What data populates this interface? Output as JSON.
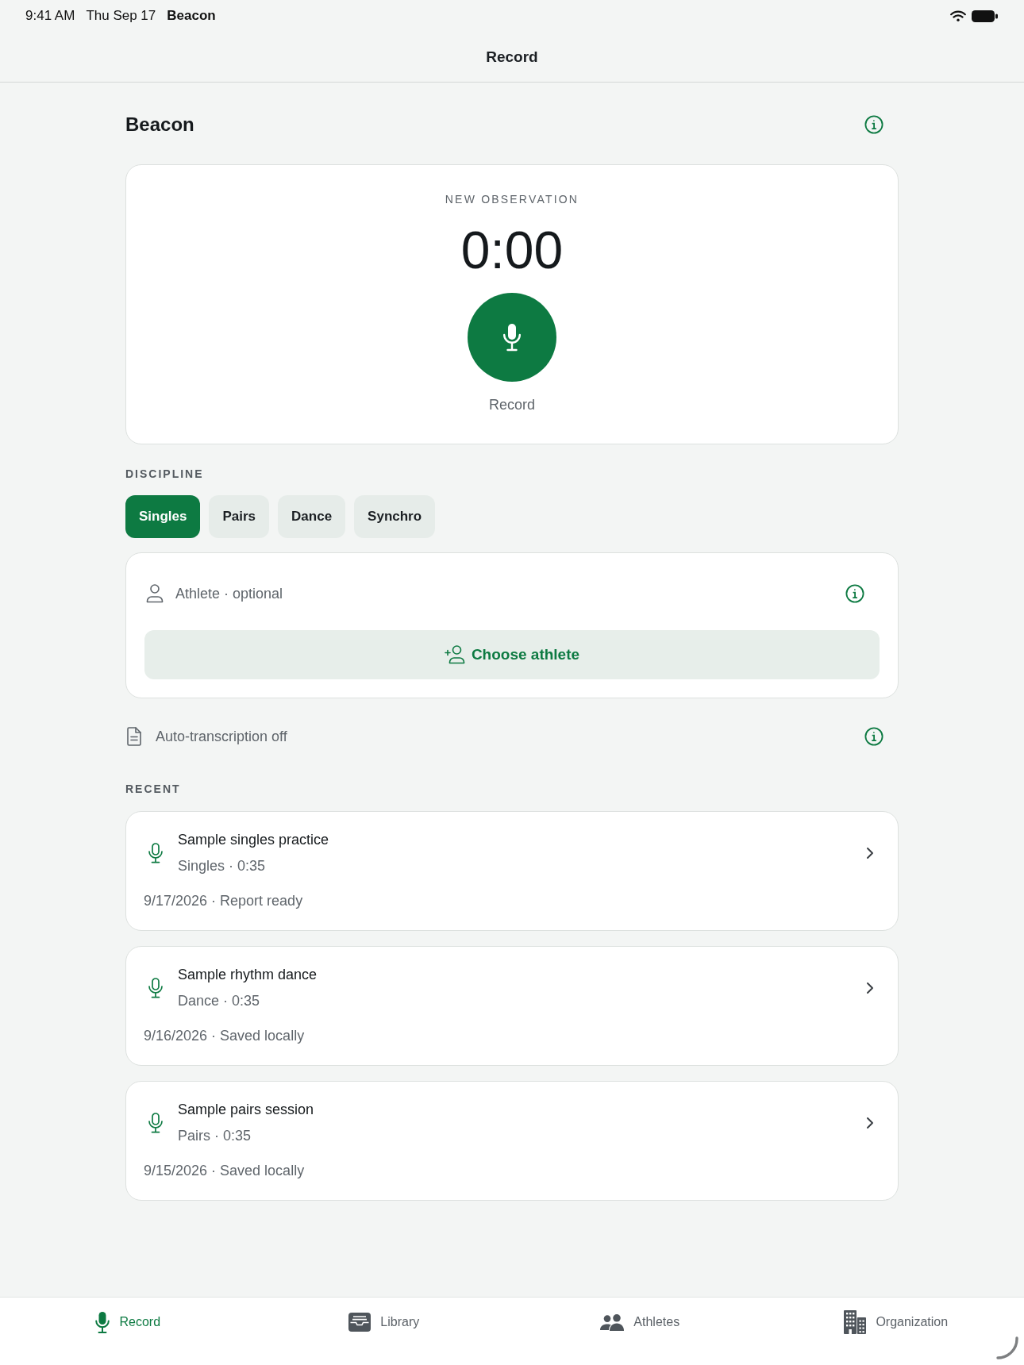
{
  "status_bar": {
    "time": "9:41 AM",
    "date": "Thu Sep 17",
    "app_name": "Beacon"
  },
  "nav_bar": {
    "title": "Record"
  },
  "header": {
    "title": "Beacon"
  },
  "record_card": {
    "label": "NEW OBSERVATION",
    "timer": "0:00",
    "button_label": "Record"
  },
  "discipline": {
    "heading": "DISCIPLINE",
    "options": [
      {
        "label": "Singles",
        "selected": true
      },
      {
        "label": "Pairs",
        "selected": false
      },
      {
        "label": "Dance",
        "selected": false
      },
      {
        "label": "Synchro",
        "selected": false
      }
    ]
  },
  "athlete": {
    "label": "Athlete · optional",
    "button": "Choose athlete"
  },
  "transcription": {
    "label": "Auto-transcription off"
  },
  "recent": {
    "heading": "RECENT",
    "items": [
      {
        "title": "Sample singles practice",
        "detail": "Singles · 0:35",
        "date_status": "9/17/2026 · Report ready"
      },
      {
        "title": "Sample rhythm dance",
        "detail": "Dance · 0:35",
        "date_status": "9/16/2026 · Saved locally"
      },
      {
        "title": "Sample pairs session",
        "detail": "Pairs · 0:35",
        "date_status": "9/15/2026 · Saved locally"
      }
    ]
  },
  "tab_bar": {
    "items": [
      {
        "label": "Record",
        "selected": true
      },
      {
        "label": "Library",
        "selected": false
      },
      {
        "label": "Athletes",
        "selected": false
      },
      {
        "label": "Organization",
        "selected": false
      }
    ]
  }
}
